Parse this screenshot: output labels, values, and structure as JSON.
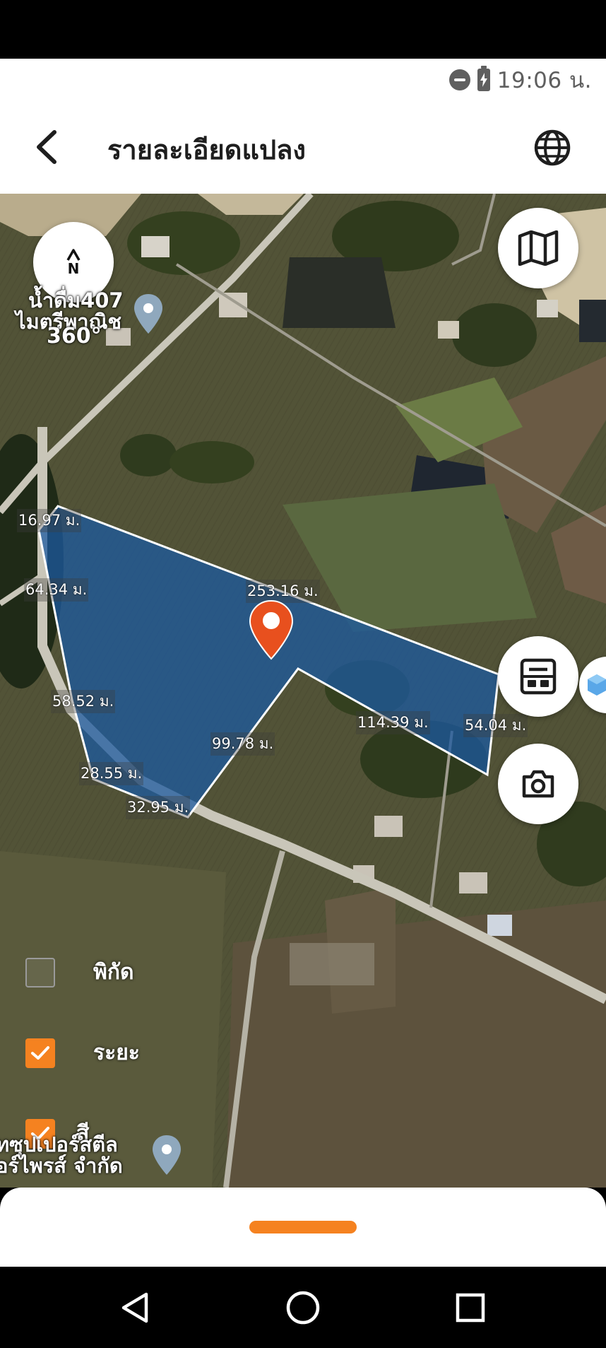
{
  "status_bar": {
    "time": "19:06 น.",
    "icons": [
      "do-not-disturb-icon",
      "battery-charging-icon"
    ]
  },
  "header": {
    "title": "รายละเอียดแปลง",
    "back_icon": "chevron-left-icon",
    "globe_icon": "globe-icon"
  },
  "map": {
    "compass": {
      "north_label": "N",
      "heading_text": "360°"
    },
    "poi_labels": {
      "top": [
        "น้ำดื่ม407",
        "ไมตรีพาณิช"
      ],
      "bottom": [
        "ทซุปเปอร์สตีล",
        "อร์ไพรส์ จำกัด"
      ]
    },
    "distances": {
      "d1": "16.97 ม.",
      "d2": "64.34 ม.",
      "d3": "253.16 ม.",
      "d4": "58.52 ม.",
      "d5": "114.39 ม.",
      "d6": "54.04 ม.",
      "d7": "99.78 ม.",
      "d8": "28.55 ม.",
      "d9": "32.95 ม."
    },
    "buttons": [
      "map-layer-icon",
      "calculator-icon",
      "camera-icon",
      "cube-icon"
    ],
    "plot_color": "#1c5aa0",
    "pin_color": "#e8501e"
  },
  "toggles": [
    {
      "label": "พิกัด",
      "checked": false
    },
    {
      "label": "ระยะ",
      "checked": true
    },
    {
      "label": "สี",
      "checked": true
    }
  ],
  "accent_color": "#f58220",
  "nav": [
    "back-triangle-icon",
    "home-circle-icon",
    "recents-square-icon"
  ]
}
